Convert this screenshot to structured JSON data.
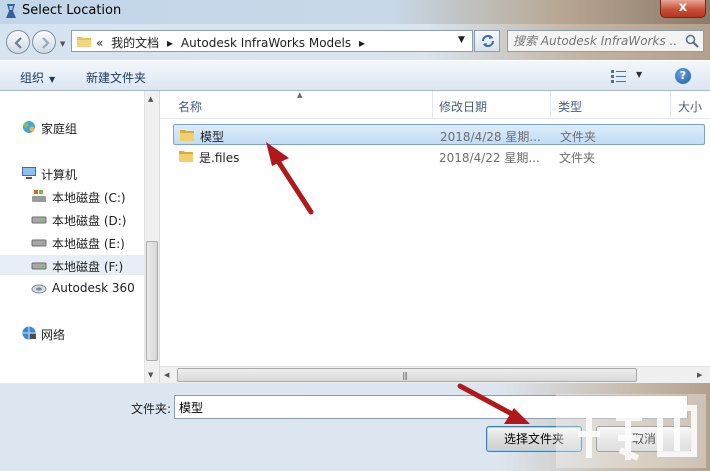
{
  "window": {
    "title": "Select Location",
    "close_glyph": "x"
  },
  "navigation": {
    "back_icon": "back-arrow-icon",
    "forward_icon": "forward-arrow-icon"
  },
  "address": {
    "overflow": "«",
    "crumbs": [
      "我的文档",
      "Autodesk InfraWorks Models"
    ],
    "separator": "▸"
  },
  "search": {
    "placeholder": "搜索 Autodesk InfraWorks ..."
  },
  "commands": {
    "organize": "组织",
    "new_folder": "新建文件夹"
  },
  "sidebar": {
    "items": [
      {
        "label": "家庭组",
        "icon": "homegroup-icon"
      },
      {
        "label": "计算机",
        "icon": "computer-icon"
      },
      {
        "label": "本地磁盘 (C:)",
        "icon": "system-drive-icon"
      },
      {
        "label": "本地磁盘 (D:)",
        "icon": "drive-icon"
      },
      {
        "label": "本地磁盘 (E:)",
        "icon": "drive-icon"
      },
      {
        "label": "本地磁盘 (F:)",
        "icon": "drive-icon",
        "selected": true
      },
      {
        "label": "Autodesk 360",
        "icon": "cloud-icon"
      },
      {
        "label": "网络",
        "icon": "network-icon"
      }
    ]
  },
  "file_list": {
    "columns": [
      "名称",
      "修改日期",
      "类型",
      "大小"
    ],
    "rows": [
      {
        "name": "模型",
        "modified": "2018/4/28 星期...",
        "type": "文件夹",
        "selected": true
      },
      {
        "name": "是.files",
        "modified": "2018/4/22 星期...",
        "type": "文件夹",
        "selected": false
      }
    ]
  },
  "footer": {
    "folder_label": "文件夹:",
    "folder_value": "模型",
    "select_button": "选择文件夹",
    "cancel_button": "取消"
  },
  "colors": {
    "annotation_arrow": "#b0191b",
    "selection": "#c2dcf3",
    "folder": "#e8c25a"
  }
}
